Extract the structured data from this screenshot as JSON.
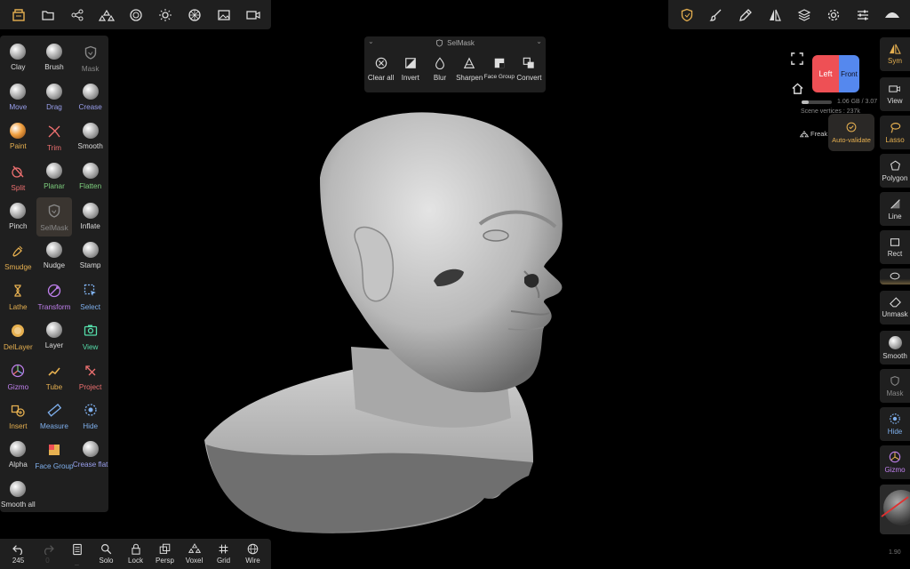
{
  "colors": {
    "accent": "#e6b050",
    "panel": "#1f1f1f",
    "selected": "#3a3530",
    "mesh": "#d0d0d0"
  },
  "top_left_icons": [
    "files-icon",
    "folder-icon",
    "share-icon",
    "hierarchy-icon",
    "material-icon",
    "sun-icon",
    "wheel-icon",
    "image-icon",
    "camera-icon"
  ],
  "top_right_icons": [
    "shield-icon",
    "brush-icon",
    "pipette-icon",
    "symmetry-icon",
    "layers-icon",
    "gear-icon",
    "sliders-icon",
    "topology-icon"
  ],
  "tools": [
    {
      "id": "clay",
      "label": "Clay",
      "color": "#dddddd",
      "icon": "sphere"
    },
    {
      "id": "brush",
      "label": "Brush",
      "color": "#dddddd",
      "icon": "sphere"
    },
    {
      "id": "mask",
      "label": "Mask",
      "color": "#888888",
      "icon": "shield"
    },
    {
      "id": "move",
      "label": "Move",
      "color": "#9aa0ee",
      "icon": "sphere"
    },
    {
      "id": "drag",
      "label": "Drag",
      "color": "#9aa0ee",
      "icon": "sphere"
    },
    {
      "id": "crease",
      "label": "Crease",
      "color": "#9aa0ee",
      "icon": "sphere"
    },
    {
      "id": "paint",
      "label": "Paint",
      "color": "#e6b050",
      "icon": "sphere-orange"
    },
    {
      "id": "trim",
      "label": "Trim",
      "color": "#ee7070",
      "icon": "trim"
    },
    {
      "id": "smooth",
      "label": "Smooth",
      "color": "#dddddd",
      "icon": "sphere"
    },
    {
      "id": "split",
      "label": "Split",
      "color": "#ee7070",
      "icon": "split"
    },
    {
      "id": "planar",
      "label": "Planar",
      "color": "#7fd07f",
      "icon": "sphere"
    },
    {
      "id": "flatten",
      "label": "Flatten",
      "color": "#7fd07f",
      "icon": "sphere"
    },
    {
      "id": "pinch",
      "label": "Pinch",
      "color": "#dddddd",
      "icon": "sphere"
    },
    {
      "id": "selmask",
      "label": "SelMask",
      "color": "#888888",
      "icon": "shield",
      "selected": true
    },
    {
      "id": "inflate",
      "label": "Inflate",
      "color": "#dddddd",
      "icon": "sphere"
    },
    {
      "id": "smudge",
      "label": "Smudge",
      "color": "#e6b050",
      "icon": "smudge"
    },
    {
      "id": "nudge",
      "label": "Nudge",
      "color": "#dddddd",
      "icon": "sphere"
    },
    {
      "id": "stamp",
      "label": "Stamp",
      "color": "#dddddd",
      "icon": "sphere"
    },
    {
      "id": "lathe",
      "label": "Lathe",
      "color": "#e6b050",
      "icon": "lathe"
    },
    {
      "id": "transform",
      "label": "Transform",
      "color": "#c080ee",
      "icon": "transform"
    },
    {
      "id": "select",
      "label": "Select",
      "color": "#7fb0ee",
      "icon": "select"
    },
    {
      "id": "dellayer",
      "label": "DelLayer",
      "color": "#e6b050",
      "icon": "dellayer"
    },
    {
      "id": "layer",
      "label": "Layer",
      "color": "#dddddd",
      "icon": "sphere"
    },
    {
      "id": "view",
      "label": "View",
      "color": "#55ddaa",
      "icon": "camera"
    },
    {
      "id": "gizmo",
      "label": "Gizmo",
      "color": "#c080ee",
      "icon": "gizmo"
    },
    {
      "id": "tube",
      "label": "Tube",
      "color": "#e6b050",
      "icon": "tube"
    },
    {
      "id": "project",
      "label": "Project",
      "color": "#ee7070",
      "icon": "project"
    },
    {
      "id": "insert",
      "label": "Insert",
      "color": "#e6b050",
      "icon": "insert"
    },
    {
      "id": "measure",
      "label": "Measure",
      "color": "#7fb0ee",
      "icon": "measure"
    },
    {
      "id": "hide",
      "label": "Hide",
      "color": "#7fb0ee",
      "icon": "hide"
    },
    {
      "id": "alpha",
      "label": "Alpha",
      "color": "#dddddd",
      "icon": "sphere"
    },
    {
      "id": "facegroup",
      "label": "Face Group",
      "color": "#7fb0ee",
      "icon": "facegroup"
    },
    {
      "id": "creaseflat",
      "label": "Crease flat",
      "color": "#9aa0ee",
      "icon": "sphere"
    },
    {
      "id": "smoothall",
      "label": "Smooth all",
      "color": "#dddddd",
      "icon": "sphere"
    }
  ],
  "selmask": {
    "title": "SelMask",
    "actions": [
      {
        "id": "clear-all",
        "label": "Clear all"
      },
      {
        "id": "invert",
        "label": "Invert"
      },
      {
        "id": "blur",
        "label": "Blur"
      },
      {
        "id": "sharpen",
        "label": "Sharpen"
      },
      {
        "id": "face-group",
        "label": "Face Group"
      },
      {
        "id": "convert",
        "label": "Convert"
      }
    ]
  },
  "right": {
    "sym": "Sym",
    "view": "View",
    "lasso": "Lasso",
    "polygon": "Polygon",
    "line": "Line",
    "rect": "Rect",
    "unmask": "Unmask",
    "smooth": "Smooth",
    "mask": "Mask",
    "hide": "Hide",
    "gizmo": "Gizmo"
  },
  "viewcube": {
    "left": "Left",
    "front": "Front"
  },
  "status": {
    "memory": "1.06 GB / 3.07",
    "scene_vertices": "Scene vertices : 237k",
    "object": "Freak"
  },
  "tooltip": "Auto-validate",
  "bottom": {
    "undo_count": "245",
    "redo_count": "0",
    "items": [
      {
        "id": "solo",
        "label": "Solo"
      },
      {
        "id": "lock",
        "label": "Lock"
      },
      {
        "id": "persp",
        "label": "Persp"
      },
      {
        "id": "voxel",
        "label": "Voxel"
      },
      {
        "id": "grid",
        "label": "Grid"
      },
      {
        "id": "wire",
        "label": "Wire"
      }
    ]
  },
  "version": "1.90"
}
